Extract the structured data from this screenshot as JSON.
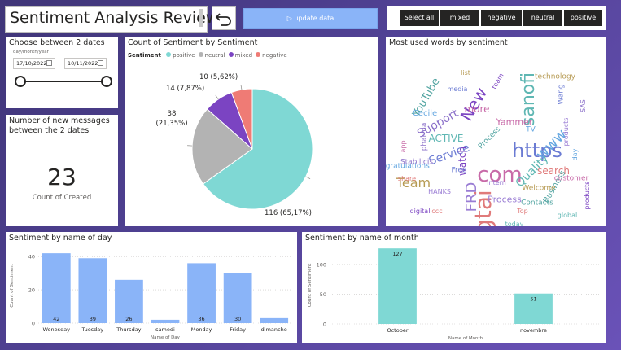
{
  "header": {
    "title": "Sentiment Analysis Review",
    "update_label": "update data",
    "slicer_buttons": [
      "Select all",
      "mixed",
      "negative",
      "neutral",
      "positive"
    ]
  },
  "date_filter": {
    "title": "Choose between 2 dates",
    "format_label": "day/month/year",
    "start_date": "17/10/2022",
    "end_date": "10/11/2022"
  },
  "kpi": {
    "title": "Number of new messages between the 2 dates",
    "value": "23",
    "label": "Count of Created"
  },
  "pie_chart": {
    "title": "Count of Sentiment by Sentiment",
    "legend_title": "Sentiment"
  },
  "wordcloud": {
    "title": "Most used words by sentiment",
    "words": [
      "https",
      "com",
      "sanofi",
      "New",
      "gtai",
      "www",
      "FRD",
      "YouTube",
      "Team",
      "Support",
      "Service",
      "more",
      "Quality",
      "watch",
      "search",
      "Cecile",
      "Process",
      "Business",
      "technology",
      "pharma",
      "media",
      "customer",
      "global",
      "digital",
      "share",
      "Congratulations",
      "products",
      "Contacts",
      "Welcome",
      "Stabilicis",
      "Wang",
      "Yammer",
      "ACTIVE",
      "team",
      "Top",
      "day",
      "HANKS",
      "Process",
      "list",
      "SAS",
      "Free",
      "app",
      "today",
      "products",
      "ccc",
      "TV",
      "Intern"
    ]
  },
  "day_chart": {
    "title": "Sentiment by name of day"
  },
  "month_chart": {
    "title": "Sentiment by name of month"
  },
  "chart_data": [
    {
      "type": "pie",
      "title": "Count of Sentiment by Sentiment",
      "legend_title": "Sentiment",
      "legend_position": "top-left",
      "slices": [
        {
          "name": "positive",
          "value": 116,
          "label": "116 (65,17%)",
          "color": "#7fd8d4"
        },
        {
          "name": "neutral",
          "value": 38,
          "label": "38 (21,35%)",
          "color": "#b3b3b3"
        },
        {
          "name": "mixed",
          "value": 14,
          "label": "14 (7,87%)",
          "color": "#7b44c2"
        },
        {
          "name": "negative",
          "value": 10,
          "label": "10 (5,62%)",
          "color": "#ef7b75"
        }
      ]
    },
    {
      "type": "bar",
      "title": "Sentiment by name of day",
      "categories": [
        "Wenesday",
        "Tuesday",
        "Thursday",
        "samedi",
        "Monday",
        "Friday",
        "dimanche"
      ],
      "values": [
        42,
        39,
        26,
        2,
        36,
        30,
        3
      ],
      "labels": [
        "42",
        "39",
        "26",
        "",
        "36",
        "30",
        ""
      ],
      "xlabel": "Name of Day",
      "ylabel": "Count of Sentiment",
      "ylim": [
        0,
        45
      ],
      "yticks": [
        0,
        20,
        40
      ],
      "color": "#8ab4f8",
      "grid": true
    },
    {
      "type": "bar",
      "title": "Sentiment by name of month",
      "categories": [
        "October",
        "novembre"
      ],
      "values": [
        127,
        51
      ],
      "labels": [
        "127",
        "51"
      ],
      "xlabel": "Name of Month",
      "ylabel": "Count of Sentiment",
      "ylim": [
        0,
        130
      ],
      "yticks": [
        0,
        50,
        100
      ],
      "color": "#7fd8d4",
      "grid": true
    }
  ]
}
